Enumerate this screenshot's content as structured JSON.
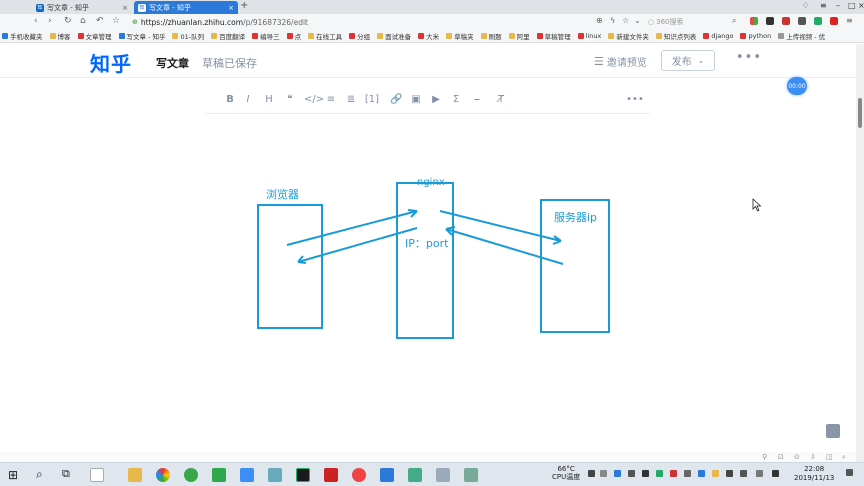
{
  "browser": {
    "tabs": [
      {
        "label": "写文章 - 知乎",
        "active": false
      },
      {
        "label": "写文章 - 知乎",
        "active": true
      }
    ],
    "new_tab": "+",
    "url_host": "https://zhuanlan.zhihu.com",
    "url_path": "/p/91687326/edit",
    "search_placeholder": "360搜索",
    "bookmarks": [
      {
        "label": "手机收藏夹",
        "icon": "blue"
      },
      {
        "label": "博客",
        "icon": "fold"
      },
      {
        "label": "文章管理",
        "icon": "red"
      },
      {
        "label": "写文章 - 知乎",
        "icon": "blue"
      },
      {
        "label": "01-队列",
        "icon": "fold"
      },
      {
        "label": "百度翻译",
        "icon": "fold"
      },
      {
        "label": "编导三",
        "icon": "red"
      },
      {
        "label": "点",
        "icon": "red"
      },
      {
        "label": "在线工具",
        "icon": "fold"
      },
      {
        "label": "分组",
        "icon": "red"
      },
      {
        "label": "面试准备",
        "icon": "fold"
      },
      {
        "label": "大米",
        "icon": "red"
      },
      {
        "label": "草稿夹",
        "icon": "fold"
      },
      {
        "label": "刷题",
        "icon": "fold"
      },
      {
        "label": "阿里",
        "icon": "fold"
      },
      {
        "label": "草稿管理",
        "icon": "red"
      },
      {
        "label": "linux",
        "icon": "red"
      },
      {
        "label": "新建文件夹",
        "icon": "fold"
      },
      {
        "label": "知识点列表",
        "icon": "fold"
      },
      {
        "label": "django",
        "icon": "red"
      },
      {
        "label": "python",
        "icon": "red"
      },
      {
        "label": "上传视频 - 优",
        "icon": "grey"
      }
    ]
  },
  "zhihu": {
    "logo": "知乎",
    "write_title": "写文章",
    "draft_status": "草稿已保存",
    "invite_preview": "邀请预览",
    "publish": "发布",
    "badge_time": "00:00"
  },
  "editor_toolbar": [
    "B",
    "I",
    "H",
    "❝",
    "</>",
    "≡",
    "≣",
    "[1]",
    "🔗",
    "▣",
    "▶",
    "Σ",
    "⎯",
    "T̸",
    "•••"
  ],
  "diagram": {
    "browser_label": "浏览器",
    "nginx_label": "nginx",
    "ip_label": "IP：port",
    "server_label": "服务器ip",
    "stroke_color": "#1a9ad6"
  },
  "taskbar": {
    "temp": "66°C",
    "temp_label": "CPU温度",
    "time": "22:08",
    "date": "2019/11/13"
  }
}
